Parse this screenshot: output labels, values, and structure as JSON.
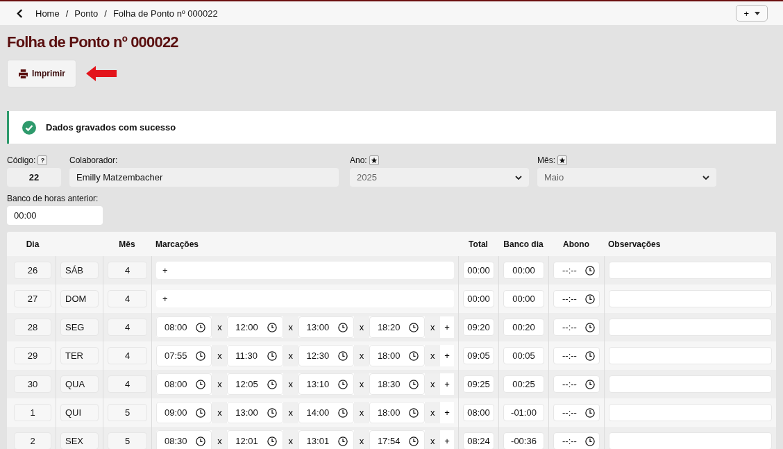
{
  "breadcrumb": {
    "items": [
      "Home",
      "Ponto",
      "Folha de Ponto nº 000022"
    ],
    "separator": "/"
  },
  "top_button": {
    "label": "+"
  },
  "title": "Folha de Ponto nº 000022",
  "print_button": {
    "label": "Imprimir"
  },
  "alert": {
    "message": "Dados gravados com sucesso"
  },
  "form": {
    "code": {
      "label": "Código:",
      "help": "?",
      "value": "22"
    },
    "employee": {
      "label": "Colaborador:",
      "value": "Emilly Matzembacher"
    },
    "year": {
      "label": "Ano:",
      "value": "2025"
    },
    "month": {
      "label": "Mês:",
      "value": "Maio"
    },
    "previous_balance": {
      "label": "Banco de horas anterior:",
      "value": "00:00"
    }
  },
  "table": {
    "columns": [
      "Dia",
      "Mês",
      "Marcações",
      "Total",
      "Banco dia",
      "Abono",
      "Observações"
    ],
    "rows": [
      {
        "day": "26",
        "weekday": "SÁB",
        "month": "4",
        "marks": [],
        "add": "+",
        "total": "00:00",
        "balance": "00:00",
        "abono": "--:--"
      },
      {
        "day": "27",
        "weekday": "DOM",
        "month": "4",
        "marks": [],
        "add": "+",
        "total": "00:00",
        "balance": "00:00",
        "abono": "--:--"
      },
      {
        "day": "28",
        "weekday": "SEG",
        "month": "4",
        "marks": [
          {
            "time": "08:00",
            "remove": "x"
          },
          {
            "time": "12:00",
            "remove": "x"
          },
          {
            "time": "13:00",
            "remove": "x"
          },
          {
            "time": "18:20",
            "remove": "x"
          }
        ],
        "add": "+",
        "total": "09:20",
        "balance": "00:20",
        "abono": "--:--"
      },
      {
        "day": "29",
        "weekday": "TER",
        "month": "4",
        "marks": [
          {
            "time": "07:55",
            "remove": "x"
          },
          {
            "time": "11:30",
            "remove": "x"
          },
          {
            "time": "12:30",
            "remove": "x"
          },
          {
            "time": "18:00",
            "remove": "x"
          }
        ],
        "add": "+",
        "total": "09:05",
        "balance": "00:05",
        "abono": "--:--"
      },
      {
        "day": "30",
        "weekday": "QUA",
        "month": "4",
        "marks": [
          {
            "time": "08:00",
            "remove": "x"
          },
          {
            "time": "12:05",
            "remove": "x"
          },
          {
            "time": "13:10",
            "remove": "x"
          },
          {
            "time": "18:30",
            "remove": "x"
          }
        ],
        "add": "+",
        "total": "09:25",
        "balance": "00:25",
        "abono": "--:--"
      },
      {
        "day": "1",
        "weekday": "QUI",
        "month": "5",
        "marks": [
          {
            "time": "09:00",
            "remove": "x"
          },
          {
            "time": "13:00",
            "remove": "x"
          },
          {
            "time": "14:00",
            "remove": "x"
          },
          {
            "time": "18:00",
            "remove": "x"
          }
        ],
        "add": "+",
        "total": "08:00",
        "balance": "-01:00",
        "abono": "--:--"
      },
      {
        "day": "2",
        "weekday": "SEX",
        "month": "5",
        "marks": [
          {
            "time": "08:30",
            "remove": "x"
          },
          {
            "time": "12:01",
            "remove": "x"
          },
          {
            "time": "13:01",
            "remove": "x"
          },
          {
            "time": "17:54",
            "remove": "x"
          }
        ],
        "add": "+",
        "total": "08:24",
        "balance": "-00:36",
        "abono": "--:--"
      }
    ]
  }
}
